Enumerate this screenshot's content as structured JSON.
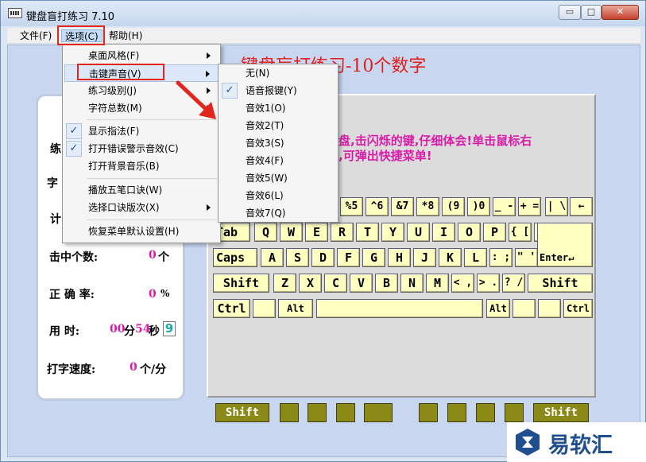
{
  "window": {
    "title": "键盘盲打练习 7.10",
    "min_glyph": "▭",
    "max_glyph": "□",
    "close_glyph": "✕"
  },
  "menubar": {
    "file": "文件(F)",
    "options": "选项(C)",
    "help": "帮助(H)"
  },
  "main_title": "键盘盲打练习-10个数字",
  "hint": {
    "line1": "盘,击闪烁的键,仔细体会!单击鼠标右",
    "line2": ",可弹出快捷菜单!"
  },
  "stats": {
    "label_practice": "练",
    "label_chars": "字",
    "label_count": "计",
    "hits_label": "击中个数:",
    "hits_value": "0",
    "hits_unit": "个",
    "accuracy_label": "正 确 率:",
    "accuracy_value": "0",
    "accuracy_unit": "%",
    "time_label": "用   时:",
    "time_min": "00",
    "time_min_unit": "分",
    "time_sec": "54",
    "time_sec_unit": "秒",
    "time_box": "9",
    "speed_label": "打字速度:",
    "speed_value": "0",
    "speed_unit": "个/分"
  },
  "options_menu": {
    "desktop_style": "桌面风格(F)",
    "key_sound": "击键声音(V)",
    "practice_level": "练习级别(J)",
    "char_total": "字符总数(M)",
    "show_fingering": "显示指法(F)",
    "error_sound": "打开错误警示音效(C)",
    "bg_music": "打开背景音乐(B)",
    "wubi_play": "播放五笔口诀(W)",
    "wubi_select": "选择口诀版次(X)",
    "restore_defaults": "恢复菜单默认设置(H)"
  },
  "sound_submenu": {
    "none": "无(N)",
    "voice": "语音报键(Y)",
    "fx1": "音效1(O)",
    "fx2": "音效2(T)",
    "fx3": "音效3(S)",
    "fx4": "音效4(F)",
    "fx5": "音效5(W)",
    "fx6": "音效6(L)",
    "fx7": "音效7(Q)"
  },
  "check_glyph": "✓",
  "keyboard": {
    "row1": [
      "%5",
      "^6",
      "&7",
      "*8",
      "(9",
      ")0",
      "_ -",
      "+ =",
      "| \\",
      "←"
    ],
    "row2": [
      "Tab",
      "Q",
      "W",
      "E",
      "R",
      "T",
      "Y",
      "U",
      "I",
      "O",
      "P",
      "{ [",
      "} ]"
    ],
    "row3": [
      "Caps",
      "A",
      "S",
      "D",
      "F",
      "G",
      "H",
      "J",
      "K",
      "L",
      ": ;",
      "\" '",
      "Enter↵"
    ],
    "row4": [
      "Shift",
      "Z",
      "X",
      "C",
      "V",
      "B",
      "N",
      "M",
      "< ,",
      "> .",
      "? /",
      "Shift"
    ],
    "row5": [
      "Ctrl",
      "",
      "Alt",
      "",
      "Alt",
      "",
      "",
      "Ctrl"
    ]
  },
  "bottom_keys": {
    "left_shift": "Shift",
    "right_shift": "Shift"
  },
  "watermark": {
    "text": "易软汇"
  }
}
